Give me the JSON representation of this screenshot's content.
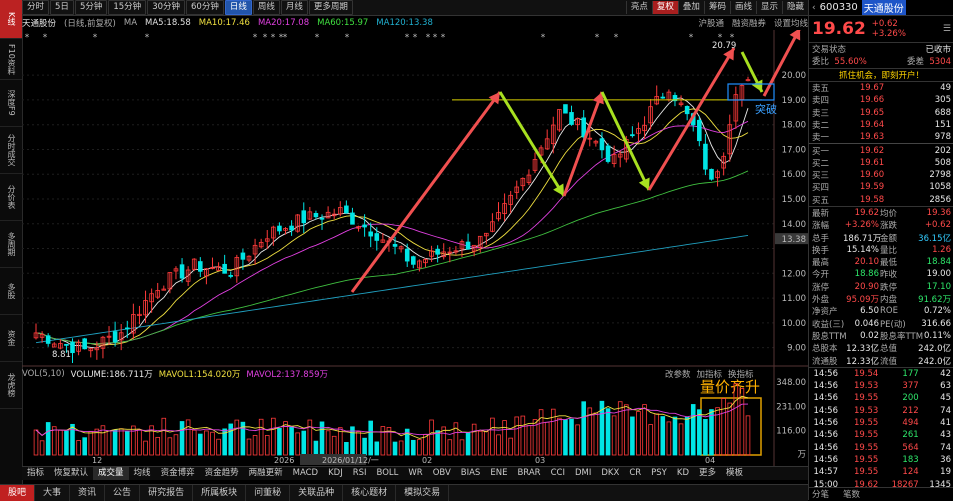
{
  "toolbar": {
    "periods": [
      "分时",
      "5日",
      "5分钟",
      "15分钟",
      "30分钟",
      "60分钟",
      "日线",
      "周线",
      "月线",
      "更多周期"
    ],
    "active_period": "日线",
    "right_items": [
      "亮点",
      "复权",
      "叠加",
      "筹码",
      "画线",
      "显示",
      "隐藏"
    ],
    "right_active": "复权"
  },
  "left_nav": [
    {
      "label": "K线",
      "active": true
    },
    {
      "label": "F10资料",
      "active": false
    },
    {
      "label": "深度F9",
      "active": false
    },
    {
      "label": "分时成交",
      "active": false
    },
    {
      "label": "分价表",
      "active": false
    },
    {
      "label": "多周期",
      "active": false
    },
    {
      "label": "多股",
      "active": false
    },
    {
      "label": "资金",
      "active": false
    },
    {
      "label": "龙虎榜",
      "active": false
    }
  ],
  "header": {
    "stock_name": "天通股份",
    "mode": "(日线,前复权)",
    "ma_label": "MA",
    "ma5": "MA5:18.58",
    "ma10": "MA10:17.46",
    "ma20": "MA20:17.08",
    "ma60": "MA60:15.97",
    "ma120": "MA120:13.38",
    "buttons": [
      "沪股通",
      "融资融券",
      "设置均线"
    ]
  },
  "price_axis": [
    "20.00",
    "19.00",
    "18.00",
    "17.00",
    "16.00",
    "15.00",
    "14.00",
    "13.38",
    "12.00",
    "11.00",
    "10.00",
    "9.00"
  ],
  "chart_labels": {
    "high": "20.79",
    "low": "8.81",
    "breakout": "突破",
    "volume_note": "量价齐升"
  },
  "volume": {
    "legend_name": "VOL(5,10)",
    "volume": "VOLUME:186.711万",
    "mavol1": "MAVOL1:154.020万",
    "mavol2": "MAVOL2:137.859万",
    "buttons": [
      "改参数",
      "加指标",
      "换指标"
    ],
    "axis": [
      "348.00",
      "231.00",
      "116.00",
      "万"
    ]
  },
  "time_axis": [
    "12",
    "2026",
    "2026/01/12/一",
    "02",
    "03",
    "04"
  ],
  "indicators": [
    "指标",
    "恢复默认",
    "成交量",
    "均线",
    "资金博弈",
    "资金趋势",
    "两融更新",
    "MACD",
    "KDJ",
    "RSI",
    "BOLL",
    "WR",
    "OBV",
    "BIAS",
    "ENE",
    "BRAR",
    "CCI",
    "DMI",
    "DKX",
    "CR",
    "PSY",
    "KD",
    "更多",
    "模板"
  ],
  "indicator_active": "成交量",
  "bottom_tabs": [
    "股吧",
    "大事",
    "资讯",
    "公告",
    "研究报告",
    "所属板块",
    "问董秘",
    "关联品种",
    "核心题材",
    "模拟交易"
  ],
  "bottom_active": "股吧",
  "quote": {
    "code": "600330",
    "name": "天通股份",
    "price": "19.62",
    "change": "+0.62",
    "change_pct": "+3.26%",
    "status_label": "交易状态",
    "status": "已收市",
    "webi_label": "委比",
    "webi": "55.60%",
    "weicha_label": "委差",
    "weicha": "5304",
    "promo": "抓住机会，即刻开户！",
    "asks": [
      {
        "label": "卖五",
        "price": "19.67",
        "vol": "49"
      },
      {
        "label": "卖四",
        "price": "19.66",
        "vol": "305"
      },
      {
        "label": "卖三",
        "price": "19.65",
        "vol": "688"
      },
      {
        "label": "卖二",
        "price": "19.64",
        "vol": "151"
      },
      {
        "label": "卖一",
        "price": "19.63",
        "vol": "978"
      }
    ],
    "bids": [
      {
        "label": "买一",
        "price": "19.62",
        "vol": "202"
      },
      {
        "label": "买二",
        "price": "19.61",
        "vol": "508"
      },
      {
        "label": "买三",
        "price": "19.60",
        "vol": "2798"
      },
      {
        "label": "买四",
        "price": "19.59",
        "vol": "1058"
      },
      {
        "label": "买五",
        "price": "19.58",
        "vol": "2856"
      }
    ],
    "stats": [
      {
        "l1": "最新",
        "v1": "19.62",
        "c1": "red",
        "l2": "均价",
        "v2": "19.36",
        "c2": "red"
      },
      {
        "l1": "涨幅",
        "v1": "+3.26%",
        "c1": "red",
        "l2": "涨跌",
        "v2": "+0.62",
        "c2": "red"
      },
      {
        "l1": "总手",
        "v1": "186.71万",
        "c1": "wht",
        "l2": "金额",
        "v2": "36.15亿",
        "c2": "cyn"
      },
      {
        "l1": "换手",
        "v1": "15.14%",
        "c1": "wht",
        "l2": "量比",
        "v2": "1.26",
        "c2": "red"
      },
      {
        "l1": "最高",
        "v1": "20.10",
        "c1": "red",
        "l2": "最低",
        "v2": "18.84",
        "c2": "grn"
      },
      {
        "l1": "今开",
        "v1": "18.86",
        "c1": "grn",
        "l2": "昨收",
        "v2": "19.00",
        "c2": "wht"
      },
      {
        "l1": "涨停",
        "v1": "20.90",
        "c1": "red",
        "l2": "跌停",
        "v2": "17.10",
        "c2": "grn"
      },
      {
        "l1": "外盘",
        "v1": "95.09万",
        "c1": "red",
        "l2": "内盘",
        "v2": "91.62万",
        "c2": "grn"
      },
      {
        "l1": "净资产",
        "v1": "6.50",
        "c1": "wht",
        "l2": "ROE",
        "v2": "0.72%",
        "c2": "wht"
      },
      {
        "l1": "收益(三)",
        "v1": "0.046",
        "c1": "wht",
        "l2": "PE(动)",
        "v2": "316.66",
        "c2": "wht"
      },
      {
        "l1": "股息TTM",
        "v1": "0.02",
        "c1": "wht",
        "l2": "股息率TTM",
        "v2": "0.11%",
        "c2": "wht"
      },
      {
        "l1": "总股本",
        "v1": "12.33亿",
        "c1": "wht",
        "l2": "总值",
        "v2": "242.0亿",
        "c2": "wht"
      },
      {
        "l1": "流通股",
        "v1": "12.33亿",
        "c1": "wht",
        "l2": "流值",
        "v2": "242.0亿",
        "c2": "wht"
      }
    ],
    "ticks": [
      {
        "t": "14:56",
        "p": "19.54",
        "v": "177",
        "n": "42"
      },
      {
        "t": "14:56",
        "p": "19.53",
        "v": "377",
        "n": "63"
      },
      {
        "t": "14:56",
        "p": "19.55",
        "v": "200",
        "n": "45"
      },
      {
        "t": "14:56",
        "p": "19.53",
        "v": "212",
        "n": "74"
      },
      {
        "t": "14:56",
        "p": "19.55",
        "v": "494",
        "n": "41"
      },
      {
        "t": "14:56",
        "p": "19.55",
        "v": "261",
        "n": "43"
      },
      {
        "t": "14:56",
        "p": "19.55",
        "v": "564",
        "n": "74"
      },
      {
        "t": "14:56",
        "p": "19.55",
        "v": "183",
        "n": "36"
      },
      {
        "t": "14:57",
        "p": "19.55",
        "v": "124",
        "n": "19"
      },
      {
        "t": "15:00",
        "p": "19.62",
        "v": "18267",
        "n": "1345"
      }
    ],
    "footer": [
      "分笔",
      "笔数"
    ]
  },
  "chart_data": {
    "type": "candlestick",
    "title": "天通股份 (日线,前复权)",
    "ylim": [
      8.5,
      21.5
    ],
    "ma_values": {
      "MA5": 18.58,
      "MA10": 17.46,
      "MA20": 17.08,
      "MA60": 15.97,
      "MA120": 13.38
    },
    "high": 20.79,
    "low": 8.81,
    "last_close": 19.62,
    "volume_ylim": [
      0,
      348
    ]
  }
}
